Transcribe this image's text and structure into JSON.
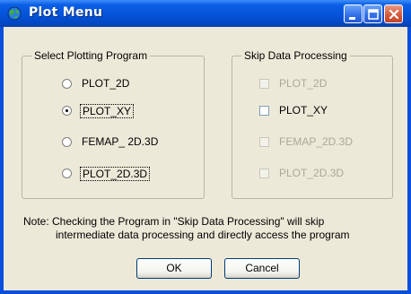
{
  "window": {
    "title": "Plot Menu"
  },
  "select_group": {
    "title": "Select Plotting Program",
    "options": [
      {
        "label": "PLOT_2D",
        "checked": false
      },
      {
        "label": "PLOT_XY",
        "checked": true
      },
      {
        "label": "FEMAP_ 2D.3D",
        "checked": false
      },
      {
        "label": "PLOT_2D.3D",
        "checked": false
      }
    ]
  },
  "skip_group": {
    "title": "Skip Data Processing",
    "options": [
      {
        "label": "PLOT_2D",
        "enabled": false,
        "checked": false
      },
      {
        "label": "PLOT_XY",
        "enabled": true,
        "checked": false
      },
      {
        "label": "FEMAP_2D.3D",
        "enabled": false,
        "checked": false
      },
      {
        "label": "PLOT_2D.3D",
        "enabled": false,
        "checked": false
      }
    ]
  },
  "note": {
    "line1": "Note: Checking the Program in \"Skip Data Processing\"  will skip",
    "line2": "intermediate data processing and directly access the program"
  },
  "buttons": {
    "ok": "OK",
    "cancel": "Cancel"
  },
  "colors": {
    "titlebar": "#0553d8",
    "dialog_bg": "#ece9d8",
    "disabled_text": "#aca899"
  }
}
